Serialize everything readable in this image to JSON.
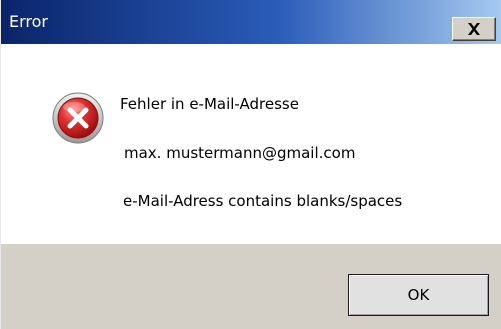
{
  "window": {
    "title": "Error",
    "close_icon": "close-x-icon"
  },
  "message": {
    "icon": "error-icon",
    "line1": "Fehler in e-Mail-Adresse",
    "line2": "max. mustermann@gmail.com",
    "line3": "e-Mail-Adress contains blanks/spaces"
  },
  "buttons": {
    "ok_label": "OK"
  },
  "colors": {
    "titlebar_start": "#0a246a",
    "titlebar_end": "#a6caf0",
    "dialog_face": "#d4d0c8",
    "error_red": "#d42020"
  }
}
